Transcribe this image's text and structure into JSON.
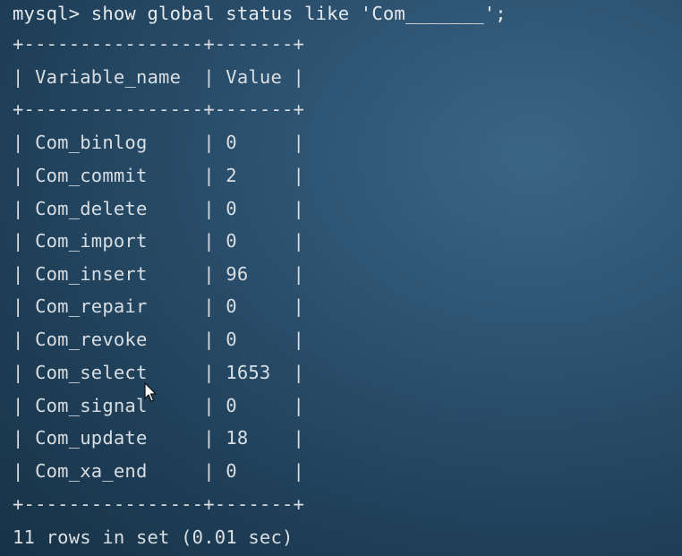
{
  "terminal": {
    "command_line": "mysql> show global status like 'Com_______';",
    "border_top": "+----------------+-------+",
    "header_row": "| Variable_name  | Value |",
    "border_mid": "+----------------+-------+",
    "rows": [
      "| Com_binlog     | 0     |",
      "| Com_commit     | 2     |",
      "| Com_delete     | 0     |",
      "| Com_import     | 0     |",
      "| Com_insert     | 96    |",
      "| Com_repair     | 0     |",
      "| Com_revoke     | 0     |",
      "| Com_select     | 1653  |",
      "| Com_signal     | 0     |",
      "| Com_update     | 18    |",
      "| Com_xa_end     | 0     |"
    ],
    "border_bottom": "+----------------+-------+",
    "result_summary": "11 rows in set (0.01 sec)"
  },
  "colors": {
    "text": "#d9dee3",
    "background": "#2c5270"
  },
  "icons": {
    "pointer": "mouse-pointer-icon"
  }
}
